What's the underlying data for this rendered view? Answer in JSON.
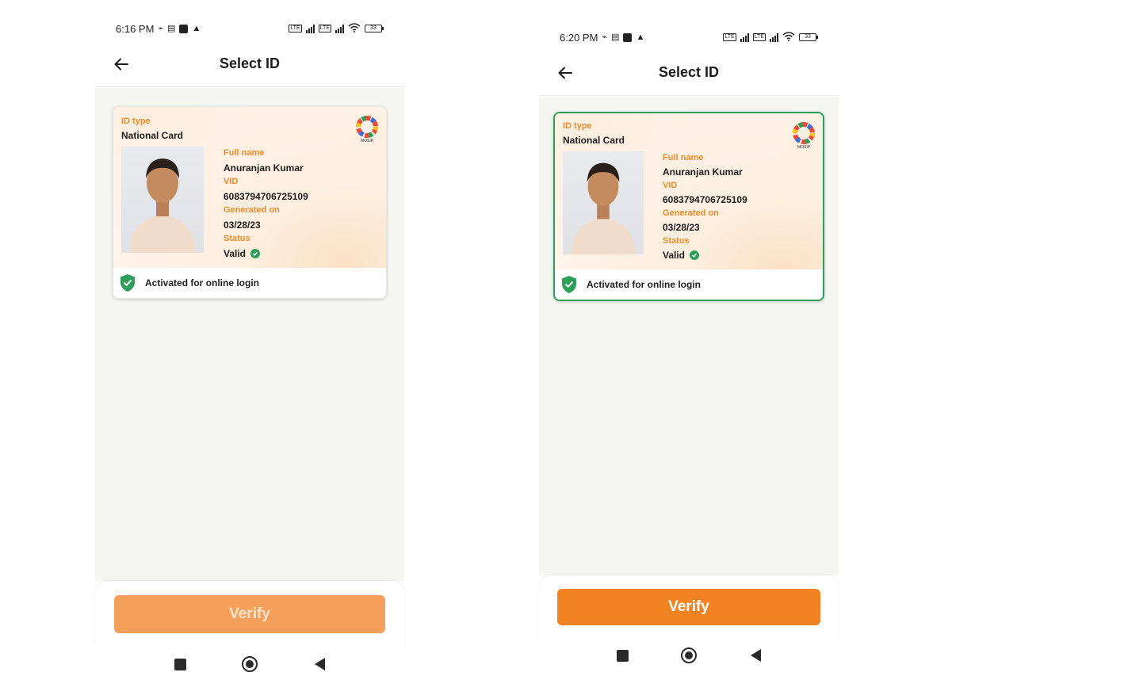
{
  "screens": [
    {
      "id": "left",
      "status_bar": {
        "time": "6:16 PM",
        "battery": "33"
      },
      "app_bar": {
        "title": "Select ID"
      },
      "card": {
        "selected": false,
        "id_type_label": "ID type",
        "id_type_value": "National Card",
        "full_name_label": "Full name",
        "full_name_value": "Anuranjan Kumar",
        "vid_label": "VID",
        "vid_value": "6083794706725109",
        "generated_on_label": "Generated on",
        "generated_on_value": "03/28/23",
        "status_label": "Status",
        "status_value": "Valid",
        "footer_text": "Activated for online login",
        "logo_text": "MOSIP"
      },
      "verify_button": {
        "label": "Verify",
        "enabled": false
      }
    },
    {
      "id": "right",
      "status_bar": {
        "time": "6:20 PM",
        "battery": "33"
      },
      "app_bar": {
        "title": "Select ID"
      },
      "card": {
        "selected": true,
        "id_type_label": "ID type",
        "id_type_value": "National Card",
        "full_name_label": "Full name",
        "full_name_value": "Anuranjan Kumar",
        "vid_label": "VID",
        "vid_value": "6083794706725109",
        "generated_on_label": "Generated on",
        "generated_on_value": "03/28/23",
        "status_label": "Status",
        "status_value": "Valid",
        "footer_text": "Activated for online login",
        "logo_text": "MOSIP"
      },
      "verify_button": {
        "label": "Verify",
        "enabled": true
      }
    }
  ],
  "colors": {
    "accent_orange": "#f28322",
    "disabled_orange": "#f4a05a",
    "label_orange": "#f08b2a",
    "selected_border_green": "#2e9e5b",
    "status_green": "#2e9e5b",
    "content_background": "#f5f5f1"
  }
}
